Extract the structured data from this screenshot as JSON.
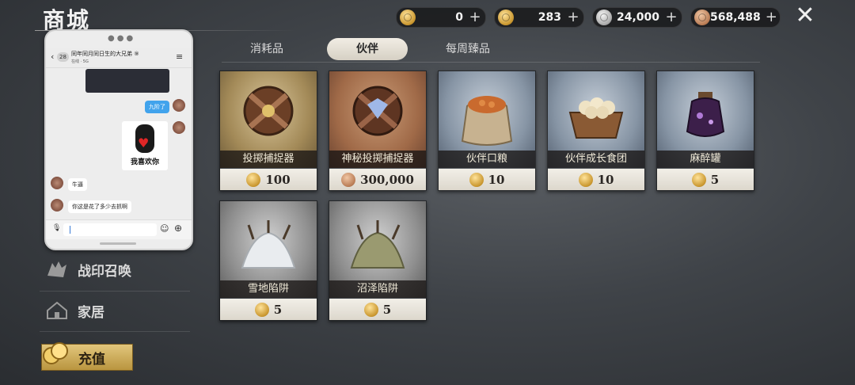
{
  "header": {
    "title": "商城"
  },
  "currencies": [
    {
      "name": "gold-ticket",
      "value": "0",
      "color": "#c9962e"
    },
    {
      "name": "gold-coin",
      "value": "283",
      "color": "#c9962e"
    },
    {
      "name": "silver-coin",
      "value": "24,000",
      "color": "#a9a9a9"
    },
    {
      "name": "copper-coin",
      "value": "568,488",
      "color": "#b97c55"
    }
  ],
  "currency_plus": "+",
  "close_icon": "✕",
  "tabs": [
    {
      "label": "消耗品",
      "active": false
    },
    {
      "label": "伙伴",
      "active": true
    },
    {
      "label": "每周臻品",
      "active": false
    }
  ],
  "items": [
    {
      "name": "投掷捕捉器",
      "price": "100",
      "coin": "gold",
      "icon": "catcher-ball-icon"
    },
    {
      "name": "神秘投掷捕捉器",
      "price": "300,000",
      "coin": "copper",
      "icon": "mystic-catcher-ball-icon"
    },
    {
      "name": "伙伴口粮",
      "price": "10",
      "coin": "gold",
      "icon": "food-sack-icon"
    },
    {
      "name": "伙伴成长食团",
      "price": "10",
      "coin": "gold",
      "icon": "food-basket-icon"
    },
    {
      "name": "麻醉罐",
      "price": "5",
      "coin": "gold",
      "icon": "anesthetic-jar-icon"
    },
    {
      "name": "雪地陷阱",
      "price": "5",
      "coin": "gold",
      "icon": "snow-trap-icon"
    },
    {
      "name": "沼泽陷阱",
      "price": "5",
      "coin": "gold",
      "icon": "swamp-trap-icon"
    }
  ],
  "menu": [
    {
      "label": "战印召唤",
      "icon": "wolf-emblem-icon"
    },
    {
      "label": "家居",
      "icon": "house-icon"
    }
  ],
  "recharge": {
    "label": "充值",
    "icon": "coin-stack-icon"
  },
  "chat": {
    "back_badge": "28",
    "title": "同年同月同日生的大兄弟 ⑨",
    "subtitle": "在线 · 5G",
    "messages": {
      "sent_text": "九阶了",
      "sticker_caption": "我喜欢你",
      "received_1": "牛逼",
      "received_2": "你这是花了多少去抓啊"
    }
  }
}
